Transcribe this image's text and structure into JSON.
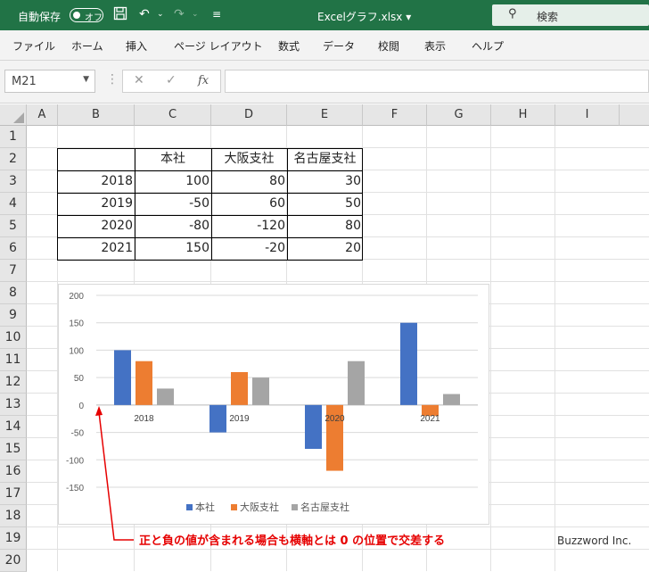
{
  "titlebar": {
    "autosave_label": "自動保存",
    "autosave_state": "オフ",
    "filename": "Excelグラフ.xlsx",
    "dropdown_glyph": "▾",
    "search_label": "検索"
  },
  "ribbon": {
    "tabs": [
      "ファイル",
      "ホーム",
      "挿入",
      "ページ レイアウト",
      "数式",
      "データ",
      "校閲",
      "表示",
      "ヘルプ"
    ]
  },
  "formula_bar": {
    "name_box": "M21",
    "fx_label": "fx",
    "formula": ""
  },
  "sheet": {
    "columns": [
      "A",
      "B",
      "C",
      "D",
      "E",
      "F",
      "G",
      "H",
      "I"
    ],
    "rows": [
      "1",
      "2",
      "3",
      "4",
      "5",
      "6",
      "7",
      "8",
      "9",
      "10",
      "11",
      "12",
      "13",
      "14",
      "15",
      "16",
      "17",
      "18",
      "19",
      "20"
    ],
    "table": {
      "headers": [
        "本社",
        "大阪支社",
        "名古屋支社"
      ],
      "rows": [
        {
          "year": "2018",
          "values": [
            "100",
            "80",
            "30"
          ]
        },
        {
          "year": "2019",
          "values": [
            "-50",
            "60",
            "50"
          ]
        },
        {
          "year": "2020",
          "values": [
            "-80",
            "-120",
            "80"
          ]
        },
        {
          "year": "2021",
          "values": [
            "150",
            "-20",
            "20"
          ]
        }
      ]
    }
  },
  "chart_data": {
    "type": "bar",
    "categories": [
      "2018",
      "2019",
      "2020",
      "2021"
    ],
    "series": [
      {
        "name": "本社",
        "values": [
          100,
          -50,
          -80,
          150
        ],
        "color": "#4472c4"
      },
      {
        "name": "大阪支社",
        "values": [
          80,
          60,
          -120,
          -20
        ],
        "color": "#ed7d31"
      },
      {
        "name": "名古屋支社",
        "values": [
          30,
          50,
          80,
          20
        ],
        "color": "#a5a5a5"
      }
    ],
    "ylim": [
      -150,
      200
    ],
    "yticks": [
      200,
      150,
      100,
      50,
      0,
      -50,
      -100,
      -150
    ],
    "grid": true,
    "legend": "bottom"
  },
  "annotation": {
    "text": "正と負の値が含まれる場合も横軸とは 0 の位置で交差する",
    "color": "#e60000"
  },
  "watermark": "Buzzword Inc."
}
